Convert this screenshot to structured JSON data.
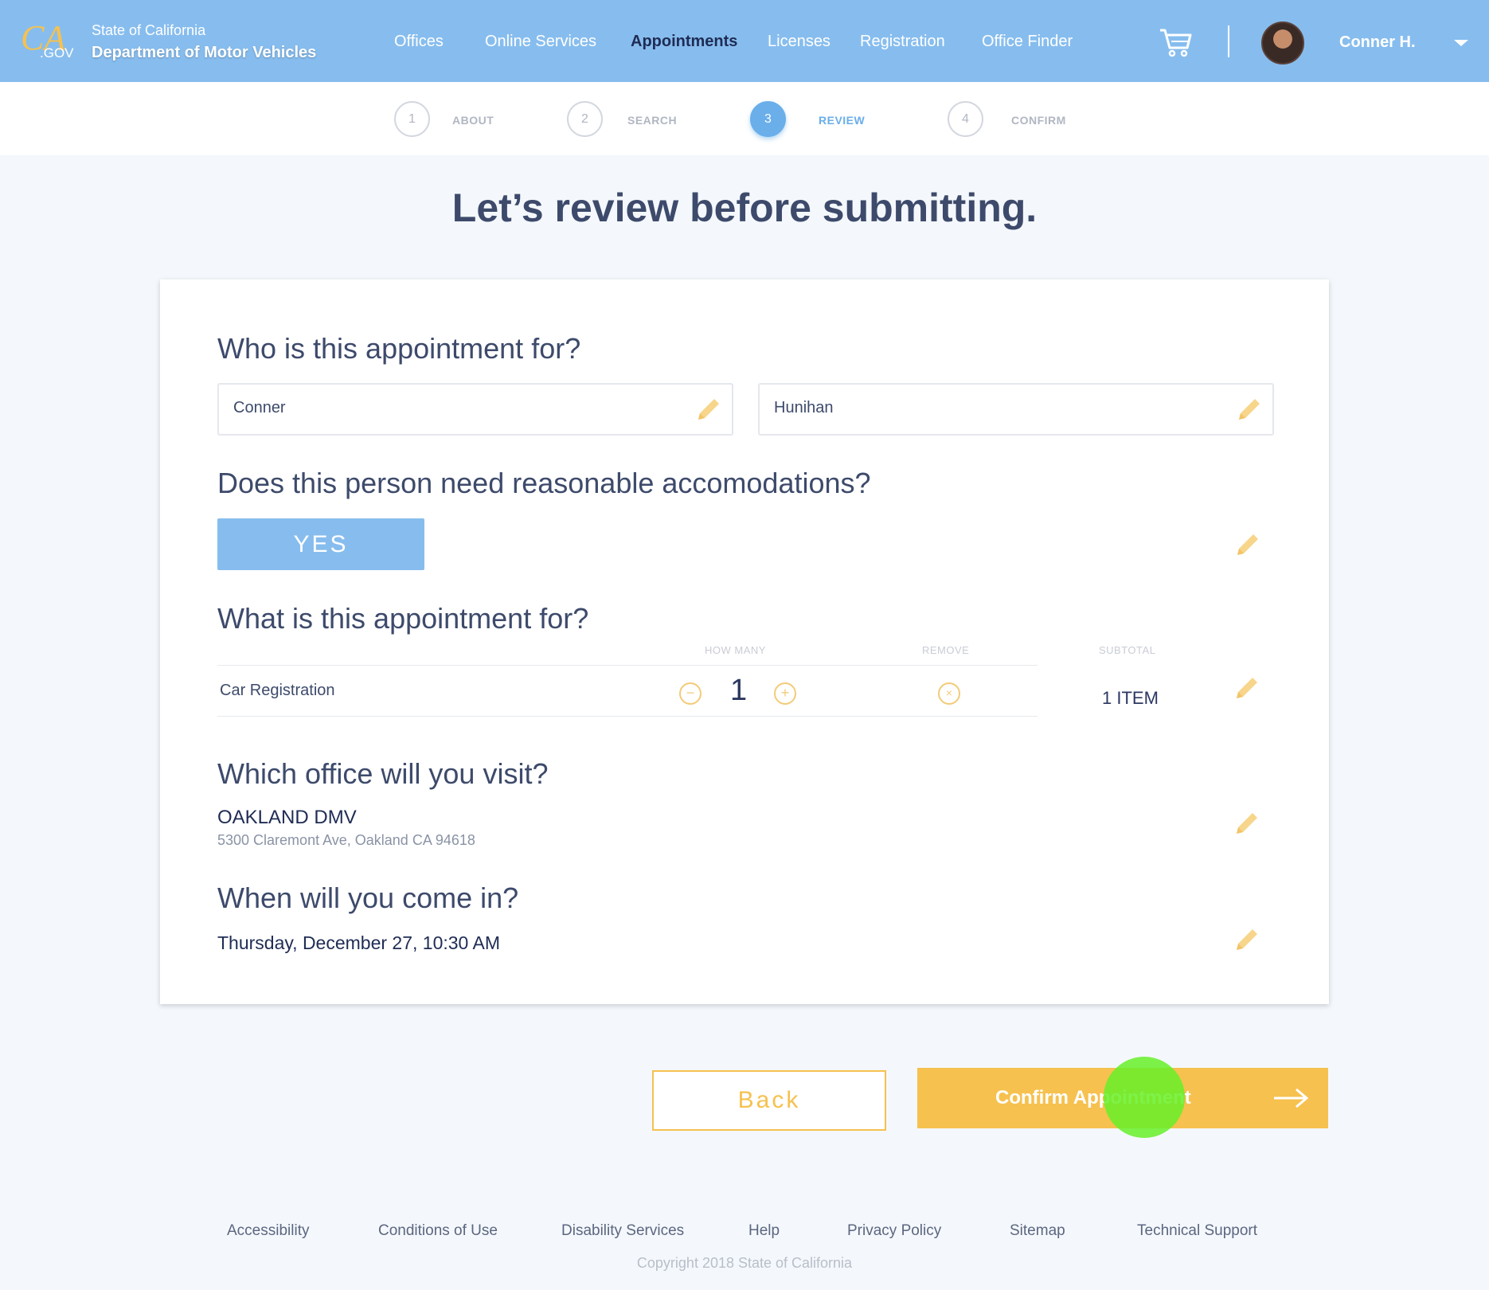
{
  "header": {
    "logo_text": "CA.GOV",
    "state": "State of California",
    "department": "Department of Motor Vehicles",
    "nav": [
      {
        "label": "Offices",
        "active": false
      },
      {
        "label": "Online Services",
        "active": false
      },
      {
        "label": "Appointments",
        "active": true
      },
      {
        "label": "Licenses",
        "active": false
      },
      {
        "label": "Registration",
        "active": false
      },
      {
        "label": "Office Finder",
        "active": false
      }
    ],
    "cart_icon": "shopping-cart-icon",
    "user_name": "Conner H.",
    "user_menu_icon": "caret-down-icon"
  },
  "stepper": [
    {
      "number": "1",
      "label": "ABOUT",
      "active": false
    },
    {
      "number": "2",
      "label": "SEARCH",
      "active": false
    },
    {
      "number": "3",
      "label": "REVIEW",
      "active": true
    },
    {
      "number": "4",
      "label": "CONFIRM",
      "active": false
    }
  ],
  "title": "Let’s review before submitting.",
  "review": {
    "who": {
      "question": "Who is this appointment for?",
      "first_name": "Conner",
      "last_name": "Hunihan"
    },
    "accommodations": {
      "question": "Does this person need reasonable accomodations?",
      "answer": "YES"
    },
    "services": {
      "question": "What is this appointment for?",
      "col_how_many": "HOW MANY",
      "col_remove": "REMOVE",
      "col_subtotal": "SUBTOTAL",
      "items": [
        {
          "name": "Car Registration",
          "quantity": "1"
        }
      ],
      "subtotal": "1 ITEM"
    },
    "office": {
      "question": "Which office will you visit?",
      "name": "OAKLAND DMV",
      "address": "5300 Claremont Ave, Oakland CA 94618"
    },
    "when": {
      "question": "When will you come in?",
      "value": "Thursday, December 27, 10:30 AM"
    }
  },
  "actions": {
    "back": "Back",
    "confirm": "Confirm Appointment"
  },
  "footer": {
    "links": [
      "Accessibility",
      "Conditions of Use",
      "Disability Services",
      "Help",
      "Privacy Policy",
      "Sitemap",
      "Technical Support"
    ],
    "copyright": "Copyright 2018 State of California"
  },
  "colors": {
    "header": "#87bdee",
    "accent_blue": "#6aaeea",
    "accent_yellow": "#f6c14f",
    "pencil": "#f7d58a",
    "cursor": "#66f028"
  }
}
